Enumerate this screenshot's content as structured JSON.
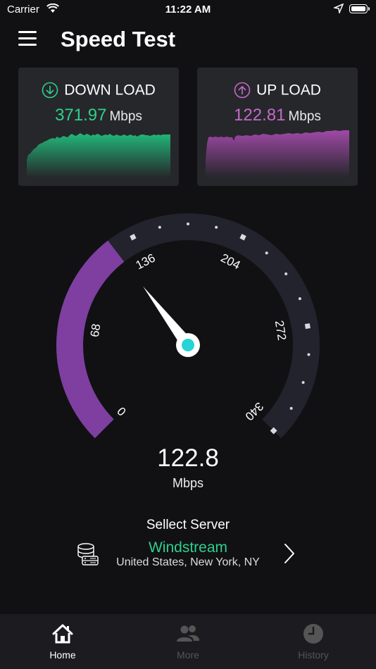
{
  "status_bar": {
    "carrier": "Carrier",
    "time": "11:22 AM"
  },
  "header": {
    "title": "Speed Test"
  },
  "download": {
    "label": "DOWN LOAD",
    "value": "371.97",
    "unit": "Mbps",
    "color": "#2dd18c"
  },
  "upload": {
    "label": "UP LOAD",
    "value": "122.81",
    "unit": "Mbps",
    "color": "#c46ac8"
  },
  "gauge": {
    "value": "122.8",
    "unit": "Mbps",
    "needle_value": 122.8,
    "scale": {
      "min": 0,
      "max": 340
    },
    "tick_labels": [
      "0",
      "68",
      "136",
      "204",
      "272",
      "340"
    ],
    "arc_color": "#7e3fa0",
    "track_color": "#23232d",
    "hub_color": "#26d3d6"
  },
  "server": {
    "title": "Sellect Server",
    "name": "Windstream",
    "location": "United States, New York, NY"
  },
  "tabs": [
    {
      "label": "Home",
      "icon": "home-icon",
      "active": true
    },
    {
      "label": "More",
      "icon": "users-icon",
      "active": false
    },
    {
      "label": "History",
      "icon": "clock-icon",
      "active": false
    }
  ]
}
